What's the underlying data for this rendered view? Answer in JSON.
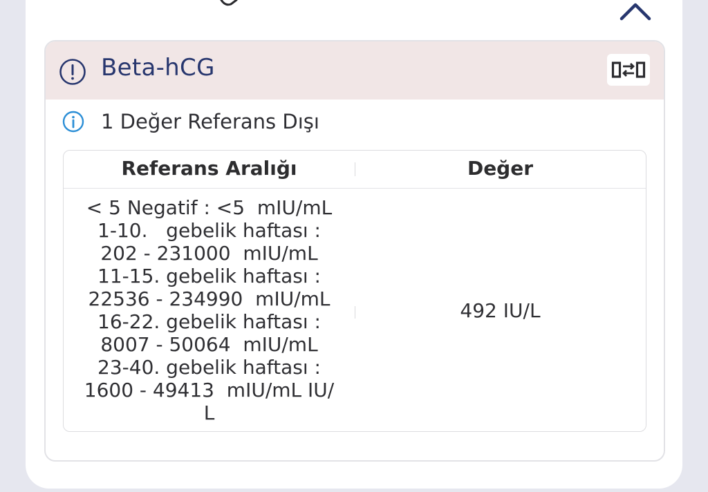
{
  "test": {
    "title": "Beta-hCG",
    "icon": "alert-circle-icon",
    "header_color": "#f1e6e6",
    "title_color": "#27366e"
  },
  "info": {
    "text": "1 Değer Referans Dışı",
    "icon": "info-circle-icon",
    "icon_color": "#2b8ed6"
  },
  "table": {
    "headers": {
      "reference": "Referans Aralığı",
      "value": "Değer"
    },
    "reference_lines": [
      "< 5 Negatif : <5  mIU/mL",
      "1-10.   gebelik haftası :",
      "202 - 231000  mIU/mL",
      "11-15. gebelik haftası :",
      "22536 - 234990  mIU/mL",
      "16-22. gebelik haftası :",
      "8007 - 50064  mIU/mL",
      "23-40. gebelik haftası :",
      "1600 - 49413  mIU/mL IU/",
      "L"
    ],
    "value": "492 IU/L"
  },
  "controls": {
    "collapse_icon": "chevron-up-icon",
    "swap_icon": "swap-horizontal-icon"
  }
}
